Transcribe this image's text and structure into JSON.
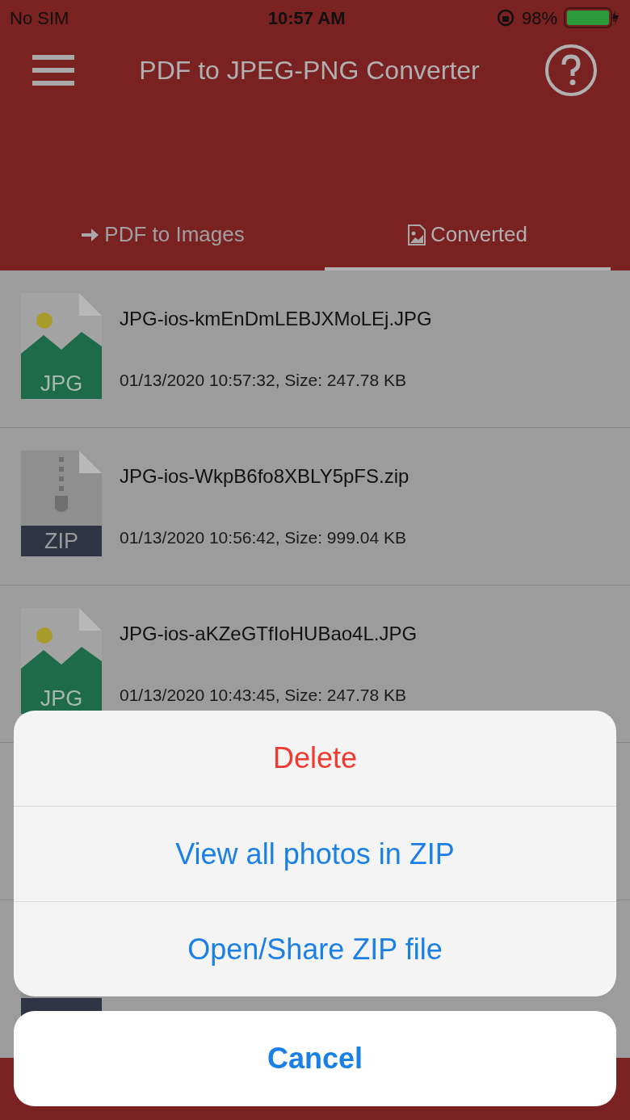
{
  "status_bar": {
    "carrier": "No SIM",
    "time": "10:57 AM",
    "battery": "98%"
  },
  "header": {
    "title": "PDF to JPEG-PNG Converter"
  },
  "tabs": [
    {
      "label": "PDF to Images",
      "selected": false,
      "kind": "arrow"
    },
    {
      "label": "Converted",
      "selected": true,
      "kind": "image"
    }
  ],
  "files": [
    {
      "kind": "image",
      "badge": "JPG",
      "name": "JPG-ios-kmEnDmLEBJXMoLEj.JPG",
      "date": "01/13/2020 10:57:32, Size: 247.78 KB"
    },
    {
      "kind": "zip",
      "badge": "ZIP",
      "name": "JPG-ios-WkpB6fo8XBLY5pFS.zip",
      "date": "01/13/2020 10:56:42, Size: 999.04 KB"
    },
    {
      "kind": "image",
      "badge": "JPG",
      "name": "JPG-ios-aKZeGTfIoHUBao4L.JPG",
      "date": "01/13/2020 10:43:45, Size: 247.78 KB"
    }
  ],
  "partial_file": {
    "kind": "zip"
  },
  "action_sheet": {
    "actions": [
      {
        "label": "Delete",
        "kind": "destructive"
      },
      {
        "label": "View all photos in ZIP",
        "kind": "default"
      },
      {
        "label": "Open/Share ZIP file",
        "kind": "default"
      }
    ],
    "cancel": "Cancel"
  }
}
